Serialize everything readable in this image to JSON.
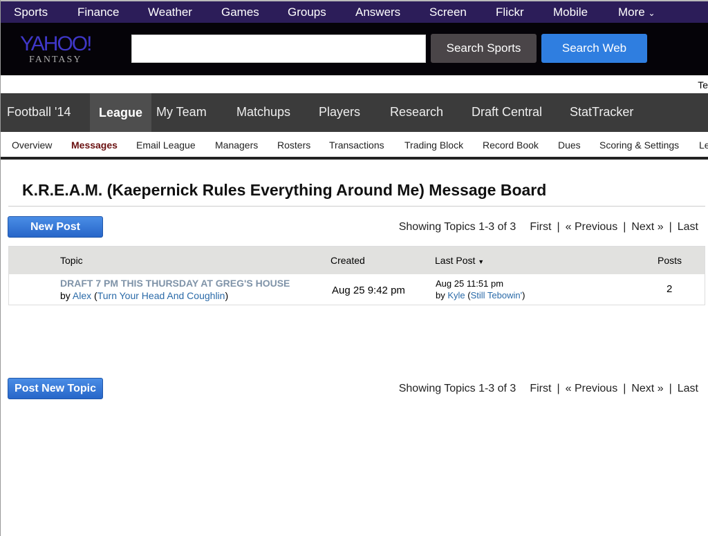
{
  "topbar": {
    "items": [
      "Sports",
      "Finance",
      "Weather",
      "Games",
      "Groups",
      "Answers",
      "Screen",
      "Flickr",
      "Mobile",
      "More"
    ]
  },
  "header": {
    "logo": "YAHOO!",
    "logo_sub": "FANTASY",
    "search_value": "",
    "search_sports": "Search Sports",
    "search_web": "Search Web",
    "right_clip": "Te"
  },
  "nav": {
    "items": [
      "Football '14",
      "League",
      "My Team",
      "Matchups",
      "Players",
      "Research",
      "Draft Central",
      "StatTracker"
    ]
  },
  "subnav": {
    "items": [
      "Overview",
      "Messages",
      "Email League",
      "Managers",
      "Rosters",
      "Transactions",
      "Trading Block",
      "Record Book",
      "Dues",
      "Scoring & Settings",
      "Le"
    ]
  },
  "page": {
    "title": "K.R.E.A.M. (Kaepernick Rules Everything Around Me) Message Board",
    "new_post": "New Post",
    "post_new_topic": "Post New Topic"
  },
  "pager": {
    "showing": "Showing Topics 1-3 of 3",
    "first": "First",
    "previous": "« Previous",
    "next": "Next »",
    "last": "Last",
    "sep": "|"
  },
  "table": {
    "headers": {
      "topic": "Topic",
      "created": "Created",
      "last_post": "Last Post",
      "posts": "Posts"
    },
    "rows": [
      {
        "title": "DRAFT 7 PM THIS THURSDAY AT GREG'S HOUSE",
        "by": "by",
        "author": "Alex",
        "team": "Turn Your Head And Coughlin",
        "created": "Aug 25 9:42 pm",
        "last_time": "Aug 25 11:51 pm",
        "last_author": "Kyle",
        "last_team": "Still Tebowin'",
        "posts": "2"
      }
    ]
  }
}
